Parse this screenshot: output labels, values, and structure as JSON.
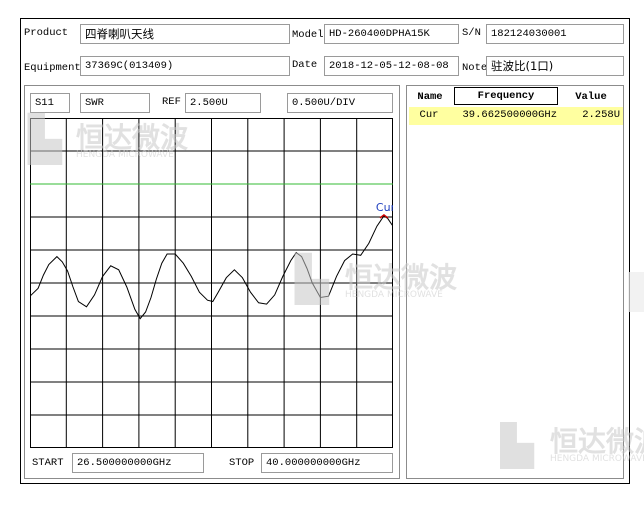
{
  "header": {
    "product_label": "Product",
    "product_value": "四脊喇叭天线",
    "model_label": "Model",
    "model_value": "HD-260400DPHA15K",
    "sn_label": "S/N",
    "sn_value": "182124030001",
    "equipment_label": "Equipment",
    "equipment_value": "37369C(013409)",
    "date_label": "Date",
    "date_value": "2018-12-05-12-08-08",
    "note_label": "Note",
    "note_value": "驻波比(1口)"
  },
  "plot_controls": {
    "param": "S11",
    "format": "SWR",
    "ref_label": "REF",
    "ref_value": "2.500U",
    "scale_value": "0.500U/DIV"
  },
  "range": {
    "start_label": "START",
    "start_value": "26.500000000GHz",
    "stop_label": "STOP",
    "stop_value": "40.000000000GHz"
  },
  "marker_table": {
    "headers": [
      "Name",
      "Frequency",
      "Value"
    ],
    "rows": [
      {
        "name": "Cur",
        "frequency": "39.662500000GHz",
        "value": "2.258U"
      }
    ]
  },
  "watermark": {
    "cn": "恒达微波",
    "en": "HENGDA MICROWAVE"
  },
  "colors": {
    "ref_line": "#33bb33",
    "trace": "#000000",
    "marker_label": "#1f3fbf",
    "marker_point": "#cc0000",
    "selected_row": "#ffffa0"
  },
  "chart_data": {
    "type": "line",
    "x_unit": "GHz",
    "y_unit": "SWR",
    "xlim": [
      26.5,
      40.0
    ],
    "ylim": [
      0.5,
      3.0
    ],
    "grid": true,
    "x_divisions": 10,
    "y_divisions": 10,
    "ref_line_value": 2.5,
    "marker": {
      "label": "Cur",
      "x": 39.6625,
      "y": 2.258
    },
    "series": [
      {
        "x": [
          26.5,
          26.8,
          27.0,
          27.2,
          27.5,
          27.7,
          27.9,
          28.1,
          28.3,
          28.6,
          28.9,
          29.2,
          29.5,
          29.8,
          30.1,
          30.4,
          30.6,
          30.8,
          31.0,
          31.2,
          31.4,
          31.6,
          31.9,
          32.2,
          32.5,
          32.8,
          33.1,
          33.3,
          33.5,
          33.8,
          34.1,
          34.4,
          34.7,
          35.0,
          35.3,
          35.6,
          35.9,
          36.2,
          36.4,
          36.6,
          36.8,
          37.0,
          37.3,
          37.6,
          37.9,
          38.2,
          38.5,
          38.8,
          39.1,
          39.4,
          39.6625,
          39.8,
          40.0
        ],
        "y": [
          1.65,
          1.71,
          1.81,
          1.89,
          1.95,
          1.91,
          1.84,
          1.72,
          1.61,
          1.57,
          1.66,
          1.8,
          1.88,
          1.85,
          1.72,
          1.55,
          1.48,
          1.53,
          1.64,
          1.78,
          1.9,
          1.97,
          1.97,
          1.9,
          1.8,
          1.68,
          1.62,
          1.61,
          1.68,
          1.79,
          1.85,
          1.79,
          1.68,
          1.6,
          1.59,
          1.66,
          1.8,
          1.92,
          1.98,
          1.95,
          1.86,
          1.75,
          1.64,
          1.65,
          1.8,
          1.92,
          1.97,
          1.96,
          2.05,
          2.18,
          2.258,
          2.24,
          2.18
        ]
      }
    ]
  }
}
